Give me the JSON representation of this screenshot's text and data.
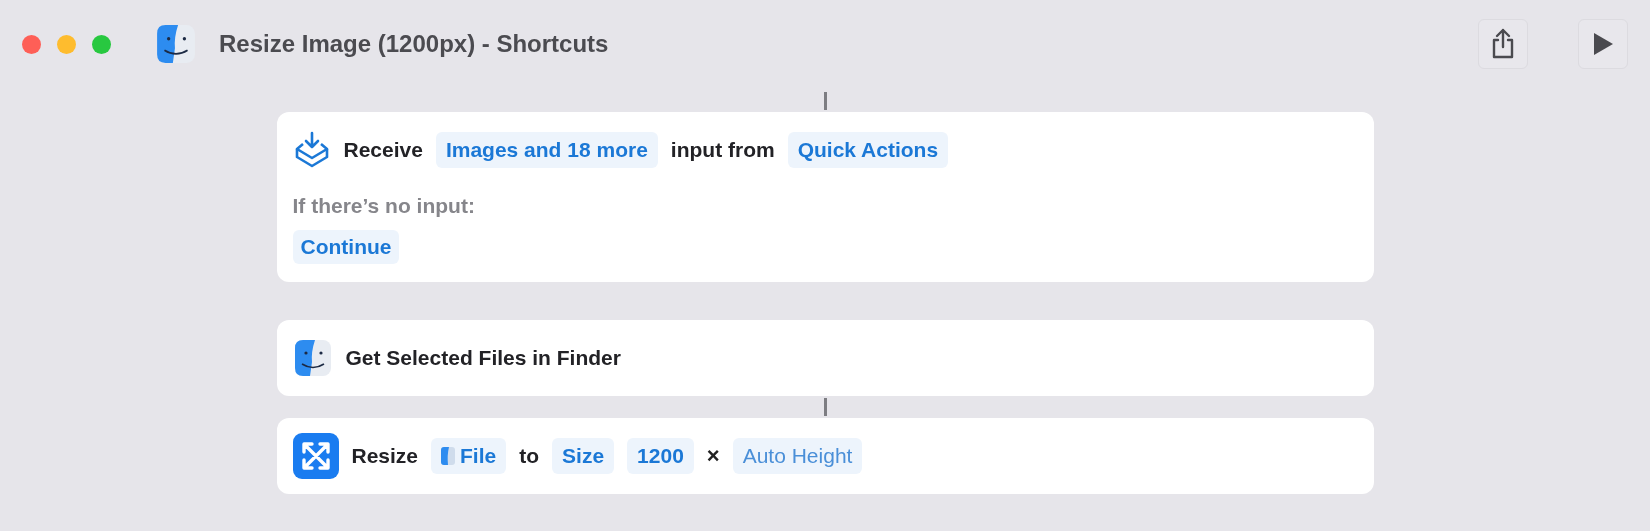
{
  "window": {
    "title": "Resize Image (1200px) - Shortcuts"
  },
  "actions": [
    {
      "parts": [
        {
          "kind": "text",
          "text": "Receive"
        },
        {
          "kind": "token",
          "text": "Images and 18 more"
        },
        {
          "kind": "text",
          "text": "input from"
        },
        {
          "kind": "token",
          "text": "Quick Actions"
        }
      ],
      "note": "If there’s no input:",
      "option": "Continue"
    },
    {
      "parts": [
        {
          "kind": "text",
          "text": "Get Selected Files in Finder"
        }
      ]
    },
    {
      "parts": [
        {
          "kind": "text",
          "text": "Resize"
        },
        {
          "kind": "file",
          "text": "File"
        },
        {
          "kind": "text",
          "text": "to"
        },
        {
          "kind": "token",
          "text": "Size"
        },
        {
          "kind": "token",
          "text": "1200"
        },
        {
          "kind": "symbol",
          "text": "×"
        },
        {
          "kind": "placeholder",
          "text": "Auto Height"
        }
      ]
    }
  ]
}
